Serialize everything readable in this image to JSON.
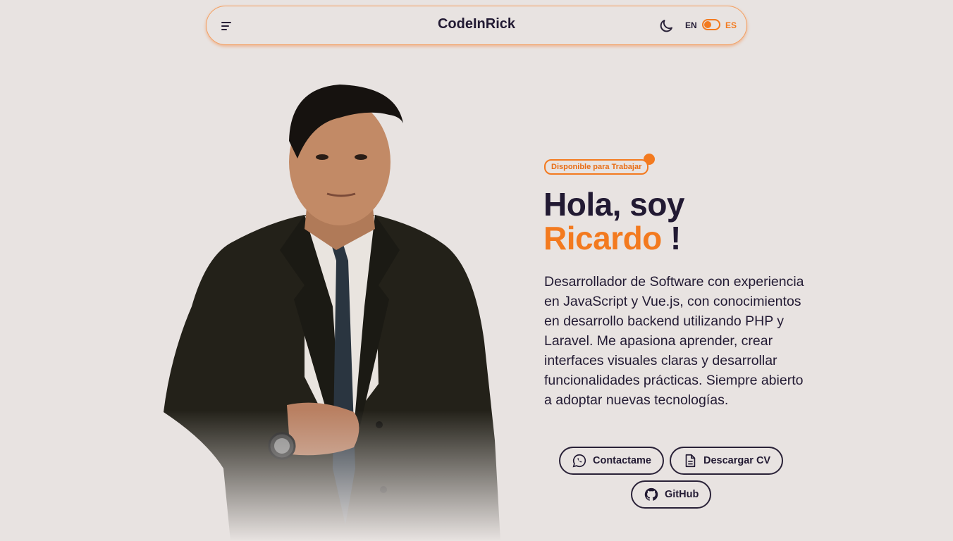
{
  "navbar": {
    "brand": "CodeInRick",
    "menu_icon": "menu-icon",
    "theme_icon": "moon-icon",
    "lang_en": "EN",
    "lang_es": "ES",
    "accent": "#f37a1f"
  },
  "hero": {
    "badge": "Disponible para Trabajar",
    "greeting": "Hola, soy",
    "name": "Ricardo",
    "exclaim": "!",
    "description": "Desarrollador de Software con experiencia en JavaScript y Vue.js, con conocimientos en desarrollo backend utilizando PHP y Laravel. Me apasiona aprender, crear interfaces visuales claras y desarrollar funcionalidades prácticas. Siempre abierto a adoptar nuevas tecnologías.",
    "buttons": {
      "contact": "Contactame",
      "cv": "Descargar CV",
      "github": "GitHub"
    }
  }
}
